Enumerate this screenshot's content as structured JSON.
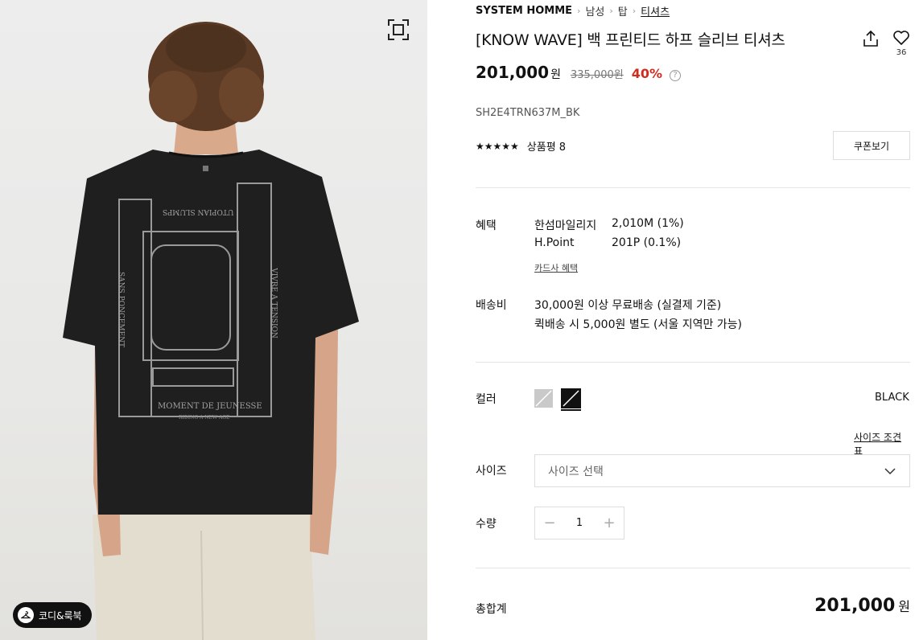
{
  "breadcrumb": {
    "brand": "SYSTEM HOMME",
    "items": [
      "남성",
      "탑",
      "티셔츠"
    ]
  },
  "product": {
    "title": "[KNOW WAVE] 백 프린티드 하프 슬리브 티셔츠",
    "like_count": "36",
    "price": "201,000",
    "currency": "원",
    "original_price": "335,000원",
    "discount": "40%",
    "sku": "SH2E4TRN637M_BK",
    "rating_stars": "★★★★★",
    "review_label": "상품평 8",
    "coupon_label": "쿠폰보기"
  },
  "print_text": {
    "top": "UTOPIAN SLUMPS",
    "left": "SANS PONCEMENT",
    "right": "VIVRE A TENSION",
    "bottom": "MOMENT DE JEUNESSE",
    "sub": "RIDING A NEW AGE"
  },
  "benefits": {
    "label": "혜택",
    "items": [
      {
        "name": "한섬마일리지",
        "value": "2,010M (1%)"
      },
      {
        "name": "H.Point",
        "value": "201P (0.1%)"
      }
    ],
    "card_link": "카드사 혜택"
  },
  "shipping": {
    "label": "배송비",
    "lines": [
      "30,000원 이상 무료배송 (실결제 기준)",
      "퀵배송 시 5,000원 별도 (서울 지역만 가능)"
    ]
  },
  "color": {
    "label": "컬러",
    "selected": "BLACK",
    "options": [
      "gray",
      "black"
    ]
  },
  "size": {
    "guide_label": "사이즈 조견표",
    "label": "사이즈",
    "placeholder": "사이즈 선택"
  },
  "quantity": {
    "label": "수량",
    "value": "1",
    "minus": "−",
    "plus": "+"
  },
  "total": {
    "label": "총합계",
    "price": "201,000",
    "currency": "원"
  },
  "codi_button": "코디&룩북",
  "colors": {
    "discount": "#d12b1f",
    "shirt": "#1f1f1f",
    "background": "#ededed"
  }
}
